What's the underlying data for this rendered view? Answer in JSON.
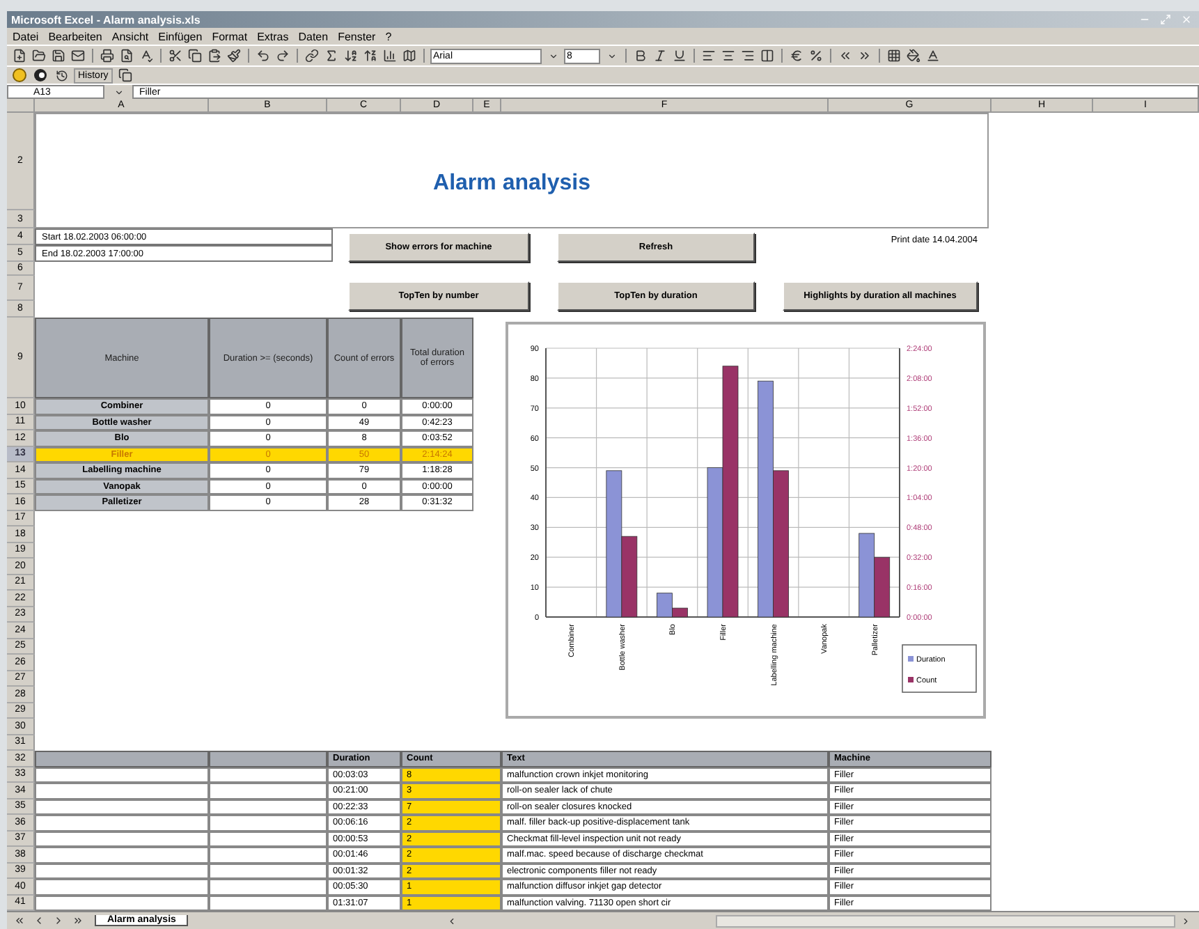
{
  "window": {
    "title": "Microsoft Excel - Alarm analysis.xls"
  },
  "menu": [
    "Datei",
    "Bearbeiten",
    "Ansicht",
    "Einfügen",
    "Format",
    "Extras",
    "Daten",
    "Fenster",
    "?"
  ],
  "toolbar": {
    "font": "Arial",
    "size": "8"
  },
  "toolbar_2": {
    "label": "History"
  },
  "formula_bar": {
    "cell": "A13",
    "value": "Filler"
  },
  "columns": [
    "A",
    "B",
    "C",
    "D",
    "E",
    "F",
    "G",
    "H",
    "I"
  ],
  "rows": [
    {
      "label": "2",
      "selected": false
    },
    {
      "label": "3",
      "selected": false
    },
    {
      "label": "4",
      "selected": false
    },
    {
      "label": "5",
      "selected": false
    },
    {
      "label": "6",
      "selected": false
    },
    {
      "label": "7",
      "selected": false
    },
    {
      "label": "8",
      "selected": false
    },
    {
      "label": "9",
      "selected": false
    },
    {
      "label": "10",
      "selected": false
    },
    {
      "label": "11",
      "selected": false
    },
    {
      "label": "12",
      "selected": false
    },
    {
      "label": "13",
      "selected": true
    },
    {
      "label": "14",
      "selected": false
    },
    {
      "label": "15",
      "selected": false
    },
    {
      "label": "16",
      "selected": false
    },
    {
      "label": "17",
      "selected": false
    },
    {
      "label": "18",
      "selected": false
    },
    {
      "label": "19",
      "selected": false
    },
    {
      "label": "20",
      "selected": false
    },
    {
      "label": "21",
      "selected": false
    },
    {
      "label": "22",
      "selected": false
    },
    {
      "label": "23",
      "selected": false
    },
    {
      "label": "24",
      "selected": false
    },
    {
      "label": "25",
      "selected": false
    },
    {
      "label": "26",
      "selected": false
    },
    {
      "label": "27",
      "selected": false
    },
    {
      "label": "28",
      "selected": false
    },
    {
      "label": "29",
      "selected": false
    },
    {
      "label": "30",
      "selected": false
    },
    {
      "label": "31",
      "selected": false
    },
    {
      "label": "32",
      "selected": false
    },
    {
      "label": "33",
      "selected": false
    },
    {
      "label": "34",
      "selected": false
    },
    {
      "label": "35",
      "selected": false
    },
    {
      "label": "36",
      "selected": false
    },
    {
      "label": "37",
      "selected": false
    },
    {
      "label": "38",
      "selected": false
    },
    {
      "label": "39",
      "selected": false
    },
    {
      "label": "40",
      "selected": false
    },
    {
      "label": "41",
      "selected": false
    }
  ],
  "report": {
    "title": "Alarm analysis",
    "start": "Start 18.02.2003 06:00:00",
    "end": "End 18.02.2003 17:00:00",
    "print_date": "Print date 14.04.2004",
    "buttons": [
      "Show errors for machine",
      "Refresh",
      "TopTen by number",
      "TopTen by duration",
      "Highlights by duration all machines"
    ]
  },
  "machine_table": {
    "columns": [
      "Machine",
      "Duration >= (seconds)",
      "Count of errors",
      "Total duration of errors"
    ],
    "rows": [
      {
        "machine": "Combiner",
        "duration": "0",
        "count": "0",
        "total": "0:00:00",
        "selected": false
      },
      {
        "machine": "Bottle washer",
        "duration": "0",
        "count": "49",
        "total": "0:42:23",
        "selected": false
      },
      {
        "machine": "Blo",
        "duration": "0",
        "count": "8",
        "total": "0:03:52",
        "selected": false
      },
      {
        "machine": "Filler",
        "duration": "0",
        "count": "50",
        "total": "2:14:24",
        "selected": true
      },
      {
        "machine": "Labelling machine",
        "duration": "0",
        "count": "79",
        "total": "1:18:28",
        "selected": false
      },
      {
        "machine": "Vanopak",
        "duration": "0",
        "count": "0",
        "total": "0:00:00",
        "selected": false
      },
      {
        "machine": "Palletizer",
        "duration": "0",
        "count": "28",
        "total": "0:31:32",
        "selected": false
      }
    ]
  },
  "chart_data": {
    "type": "bar",
    "categories": [
      "Combiner",
      "Bottle washer",
      "Blo",
      "Filler",
      "Labelling machine",
      "Vanopak",
      "Palletizer"
    ],
    "series": [
      {
        "name": "Duration",
        "color": "#8b93d6",
        "values": [
          0,
          49,
          8,
          50,
          79,
          0,
          28
        ]
      },
      {
        "name": "Count",
        "color": "#993366",
        "values": [
          0,
          27,
          3,
          84,
          49,
          0,
          20
        ]
      }
    ],
    "grid": true,
    "legend": true,
    "ylim": [
      0,
      90
    ],
    "yticks": [
      0,
      10,
      20,
      30,
      40,
      50,
      60,
      70,
      80,
      90
    ],
    "y2lim": [
      0,
      144
    ],
    "y2ticks": [
      {
        "value": 0,
        "label": "0:00:00"
      },
      {
        "value": 16,
        "label": "0:16:00"
      },
      {
        "value": 32,
        "label": "0:32:00"
      },
      {
        "value": 48,
        "label": "0:48:00"
      },
      {
        "value": 64,
        "label": "1:04:00"
      },
      {
        "value": 80,
        "label": "1:20:00"
      },
      {
        "value": 96,
        "label": "1:36:00"
      },
      {
        "value": 112,
        "label": "1:52:00"
      },
      {
        "value": 128,
        "label": "2:08:00"
      },
      {
        "value": 144,
        "label": "2:24:00"
      }
    ]
  },
  "error_table": {
    "columns": [
      "Duration",
      "Count",
      "Text",
      "Machine"
    ],
    "rows": [
      {
        "duration": "00:03:03",
        "count": "8",
        "text": "malfunction crown inkjet monitoring",
        "machine": "Filler"
      },
      {
        "duration": "00:21:00",
        "count": "3",
        "text": "roll-on sealer lack of chute",
        "machine": "Filler"
      },
      {
        "duration": "00:22:33",
        "count": "7",
        "text": "roll-on sealer closures knocked",
        "machine": "Filler"
      },
      {
        "duration": "00:06:16",
        "count": "2",
        "text": "malf. filler back-up positive-displacement tank",
        "machine": "Filler"
      },
      {
        "duration": "00:00:53",
        "count": "2",
        "text": "Checkmat fill-level inspection unit not ready",
        "machine": "Filler"
      },
      {
        "duration": "00:01:46",
        "count": "2",
        "text": "malf.mac. speed because of discharge checkmat",
        "machine": "Filler"
      },
      {
        "duration": "00:01:32",
        "count": "2",
        "text": "electronic components filler not ready",
        "machine": "Filler"
      },
      {
        "duration": "00:05:30",
        "count": "1",
        "text": "malfunction diffusor inkjet gap detector",
        "machine": "Filler"
      },
      {
        "duration": "01:31:07",
        "count": "1",
        "text": "malfunction valving. 71130 open short cir",
        "machine": "Filler"
      }
    ]
  },
  "sheet_tabs": [
    {
      "label": "Alarm analysis",
      "selected": true
    }
  ]
}
